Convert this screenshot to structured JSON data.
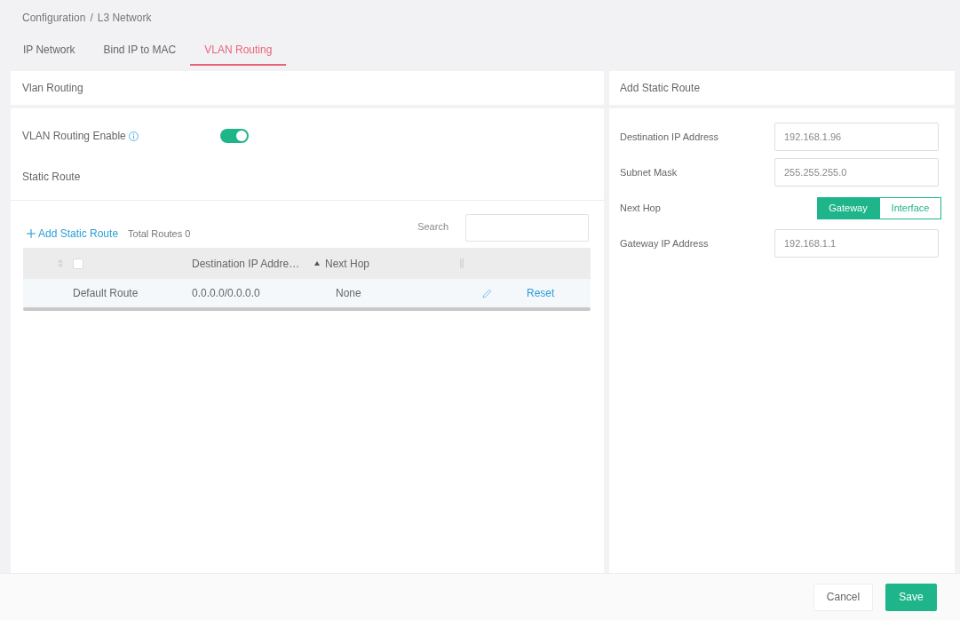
{
  "breadcrumb": {
    "items": [
      "Configuration",
      "L3 Network"
    ],
    "separator": "/"
  },
  "tabs": [
    {
      "label": "IP Network",
      "selected": false
    },
    {
      "label": "Bind IP to MAC",
      "selected": false
    },
    {
      "label": "VLAN Routing",
      "selected": true
    }
  ],
  "vlan_routing": {
    "title": "Vlan Routing",
    "enable": {
      "label": "VLAN Routing Enable",
      "on": true
    },
    "section_title": "Static Route",
    "toolbar": {
      "add_button": "Add Static Route",
      "total": "Total Routes 0",
      "search": {
        "label": "Search"
      }
    },
    "table": {
      "select_all": {
        "checked": false
      },
      "columns": [
        {
          "label": "Destination IP Addre…"
        },
        {
          "label": "Next Hop",
          "sorted_ascending": true
        }
      ],
      "rows": [
        {
          "name": "Default Route",
          "destination": "0.0.0.0/0.0.0.0",
          "next_hop": "None",
          "action": "Reset"
        }
      ]
    }
  },
  "add_static_route": {
    "title": "Add Static Route",
    "fields": [
      {
        "kind": "input",
        "label": "Destination IP Address",
        "value": "192.168.1.96"
      },
      {
        "kind": "input",
        "label": "Subnet Mask",
        "value": "255.255.255.0"
      },
      {
        "kind": "segmented",
        "label": "Next Hop",
        "options": [
          {
            "label": "Gateway",
            "selected": true
          },
          {
            "label": "Interface",
            "selected": false
          }
        ]
      },
      {
        "kind": "input",
        "label": "Gateway IP Address",
        "value": "192.168.1.1"
      }
    ]
  },
  "footer": {
    "buttons": [
      {
        "label": "Cancel",
        "kind": "secondary"
      },
      {
        "label": "Save",
        "kind": "primary"
      }
    ]
  }
}
